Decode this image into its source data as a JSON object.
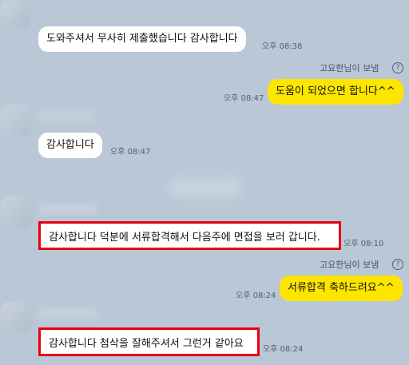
{
  "messages": [
    {
      "text": "도와주셔서 무사히 제출했습니다 감사합니다",
      "time": "오후 08:38"
    },
    {
      "sender_label": "고요한님이 보냄",
      "help_icon": "question-circle-icon",
      "text": "도움이 되었으면 합니다^^",
      "time": "오후 08:47"
    },
    {
      "text": "감사합니다",
      "time": "오후 08:47"
    },
    {
      "text": "감사합니다 덕분에 서류합격해서 다음주에 면접을 보러 갑니다.",
      "time": "오후 08:10"
    },
    {
      "sender_label": "고요한님이 보냄",
      "help_icon": "question-circle-icon",
      "text": "서류합격 축하드려요^^",
      "time": "오후 08:24"
    },
    {
      "text": "감사합니다 첨삭을 잘해주셔서 그런거 같아요",
      "time": "오후 08:24"
    }
  ],
  "colors": {
    "background": "#b9c7d6",
    "incoming_bubble": "#ffffff",
    "outgoing_bubble": "#fee500",
    "highlight_border": "#e8000b"
  }
}
